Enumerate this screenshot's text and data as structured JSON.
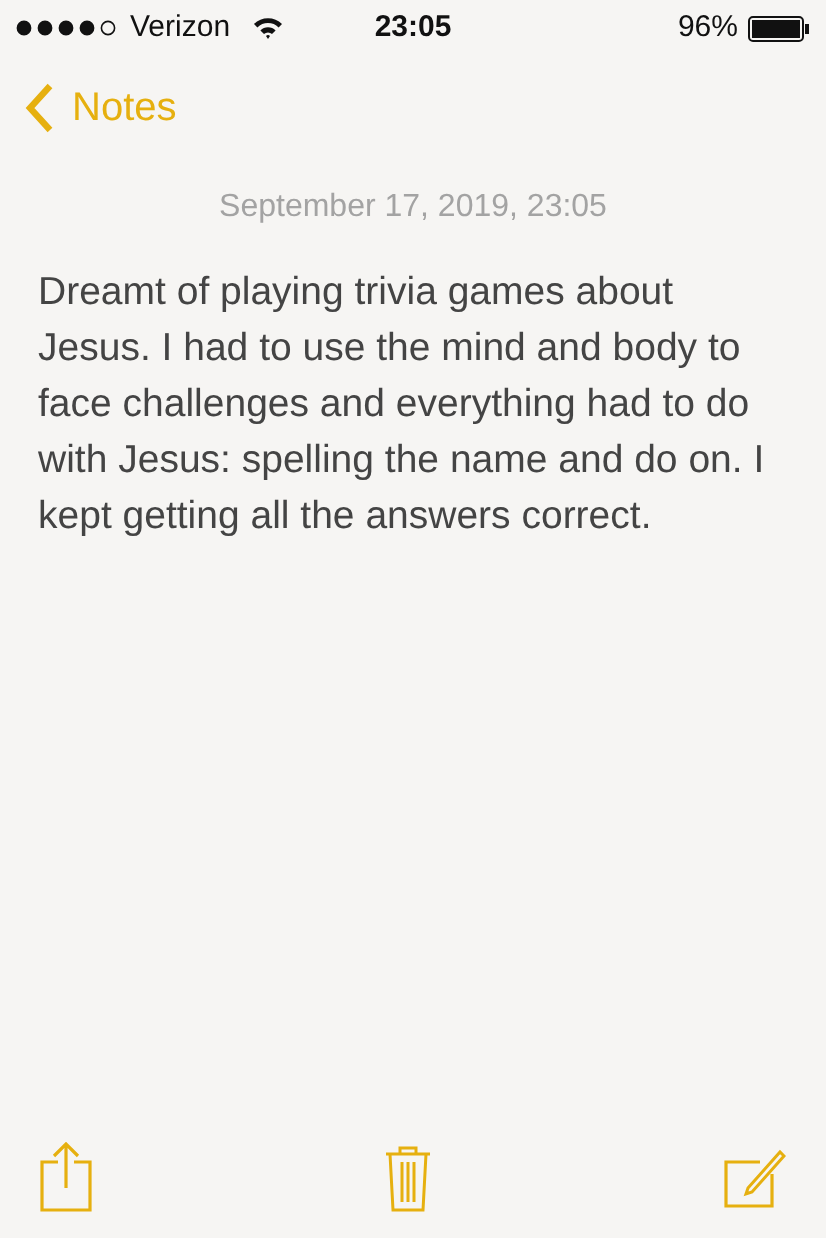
{
  "status_bar": {
    "carrier": "Verizon",
    "time": "23:05",
    "battery": "96%"
  },
  "nav": {
    "back_label": "Notes"
  },
  "note": {
    "date": "September 17, 2019, 23:05",
    "body": "Dreamt of playing trivia games about Jesus. I had to use the mind and body to face challenges and everything had to do with Jesus: spelling the name and do on. I kept getting all the answers correct."
  }
}
